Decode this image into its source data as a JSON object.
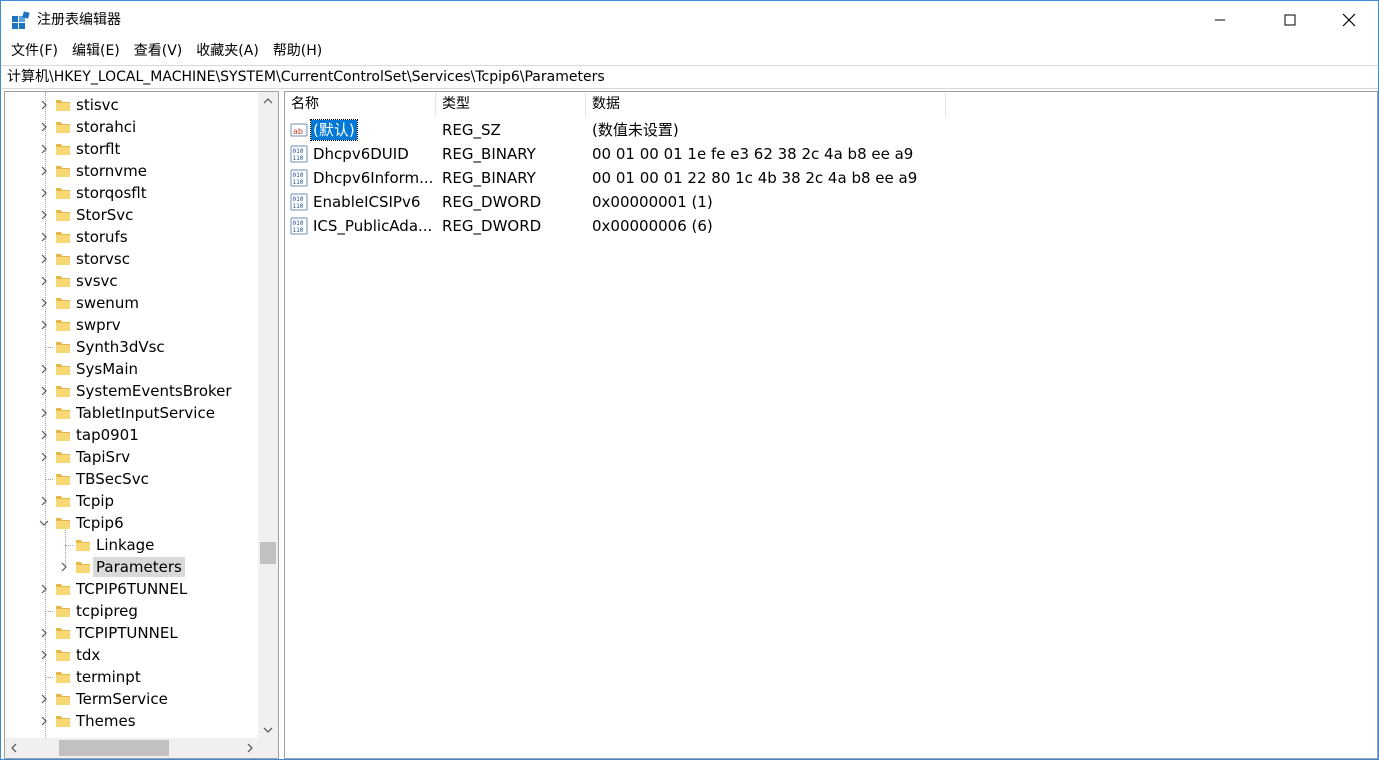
{
  "window": {
    "title": "注册表编辑器",
    "accent_color": "#0078d7"
  },
  "menu": [
    "文件(F)",
    "编辑(E)",
    "查看(V)",
    "收藏夹(A)",
    "帮助(H)"
  ],
  "address": "计算机\\HKEY_LOCAL_MACHINE\\SYSTEM\\CurrentControlSet\\Services\\Tcpip6\\Parameters",
  "tree": {
    "items": [
      {
        "label": "stisvc",
        "level": 0,
        "expander": "collapsed"
      },
      {
        "label": "storahci",
        "level": 0,
        "expander": "collapsed"
      },
      {
        "label": "storflt",
        "level": 0,
        "expander": "collapsed"
      },
      {
        "label": "stornvme",
        "level": 0,
        "expander": "collapsed"
      },
      {
        "label": "storqosflt",
        "level": 0,
        "expander": "collapsed"
      },
      {
        "label": "StorSvc",
        "level": 0,
        "expander": "collapsed"
      },
      {
        "label": "storufs",
        "level": 0,
        "expander": "collapsed"
      },
      {
        "label": "storvsc",
        "level": 0,
        "expander": "collapsed"
      },
      {
        "label": "svsvc",
        "level": 0,
        "expander": "collapsed"
      },
      {
        "label": "swenum",
        "level": 0,
        "expander": "collapsed"
      },
      {
        "label": "swprv",
        "level": 0,
        "expander": "collapsed"
      },
      {
        "label": "Synth3dVsc",
        "level": 0,
        "expander": "none"
      },
      {
        "label": "SysMain",
        "level": 0,
        "expander": "collapsed"
      },
      {
        "label": "SystemEventsBroker",
        "level": 0,
        "expander": "collapsed"
      },
      {
        "label": "TabletInputService",
        "level": 0,
        "expander": "collapsed"
      },
      {
        "label": "tap0901",
        "level": 0,
        "expander": "collapsed"
      },
      {
        "label": "TapiSrv",
        "level": 0,
        "expander": "collapsed"
      },
      {
        "label": "TBSecSvc",
        "level": 0,
        "expander": "none"
      },
      {
        "label": "Tcpip",
        "level": 0,
        "expander": "collapsed"
      },
      {
        "label": "Tcpip6",
        "level": 0,
        "expander": "expanded"
      },
      {
        "label": "Linkage",
        "level": 1,
        "expander": "none"
      },
      {
        "label": "Parameters",
        "level": 1,
        "expander": "collapsed",
        "selected": true
      },
      {
        "label": "TCPIP6TUNNEL",
        "level": 0,
        "expander": "collapsed"
      },
      {
        "label": "tcpipreg",
        "level": 0,
        "expander": "none"
      },
      {
        "label": "TCPIPTUNNEL",
        "level": 0,
        "expander": "collapsed"
      },
      {
        "label": "tdx",
        "level": 0,
        "expander": "collapsed"
      },
      {
        "label": "terminpt",
        "level": 0,
        "expander": "none"
      },
      {
        "label": "TermService",
        "level": 0,
        "expander": "collapsed"
      },
      {
        "label": "Themes",
        "level": 0,
        "expander": "collapsed"
      }
    ]
  },
  "list": {
    "columns": {
      "name": "名称",
      "type": "类型",
      "data": "数据"
    },
    "rows": [
      {
        "icon": "string-value-icon",
        "name": "(默认)",
        "type": "REG_SZ",
        "data": "(数值未设置)",
        "selected": true
      },
      {
        "icon": "binary-value-icon",
        "name": "Dhcpv6DUID",
        "type": "REG_BINARY",
        "data": "00 01 00 01 1e fe e3 62 38 2c 4a b8 ee a9"
      },
      {
        "icon": "binary-value-icon",
        "name": "Dhcpv6Inform...",
        "type": "REG_BINARY",
        "data": "00 01 00 01 22 80 1c 4b 38 2c 4a b8 ee a9"
      },
      {
        "icon": "binary-value-icon",
        "name": "EnableICSIPv6",
        "type": "REG_DWORD",
        "data": "0x00000001 (1)"
      },
      {
        "icon": "binary-value-icon",
        "name": "ICS_PublicAda...",
        "type": "REG_DWORD",
        "data": "0x00000006 (6)"
      }
    ]
  }
}
